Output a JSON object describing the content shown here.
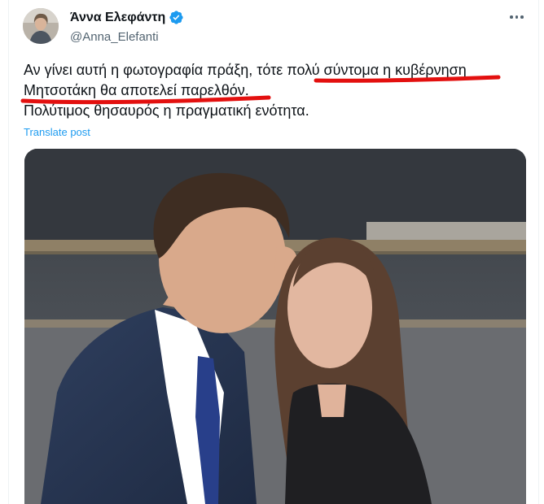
{
  "tweet": {
    "author": {
      "display_name": "Άννα Ελεφάντη",
      "handle": "@Anna_Elefanti",
      "verified_icon": "verified-badge-icon",
      "verified_color": "#1d9bf0"
    },
    "text_lines": [
      "Αν γίνει αυτή η φωτογραφία πράξη, τότε πολύ σύντομα η κυβέρνηση",
      "Μητσοτάκη θα αποτελεί παρελθόν.",
      "Πολύτιμος θησαυρός η πραγματική ενότητα."
    ],
    "translate_label": "Translate post",
    "more_icon": "more-options-icon",
    "annotation_color": "#e3100f",
    "link_color": "#1d9bf0",
    "media_icon": "photo-image"
  }
}
